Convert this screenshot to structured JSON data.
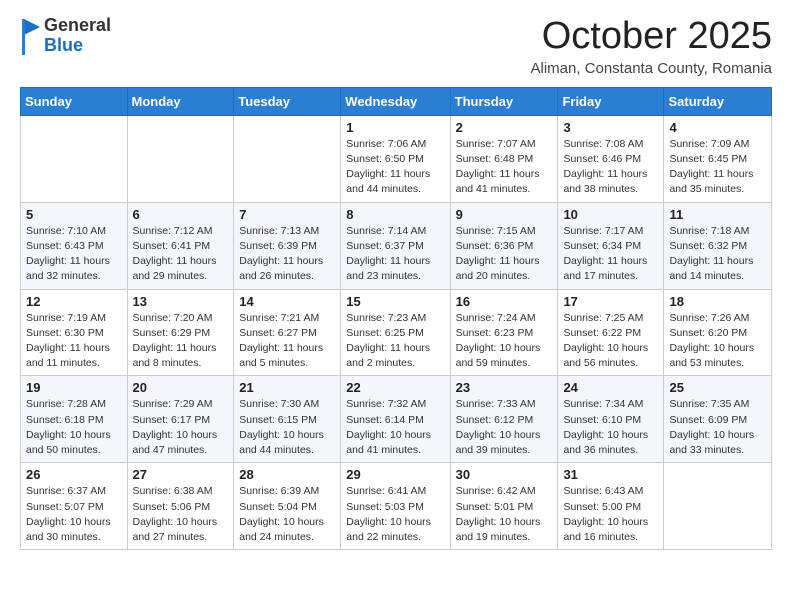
{
  "header": {
    "logo": {
      "general": "General",
      "blue": "Blue"
    },
    "title": "October 2025",
    "location": "Aliman, Constanta County, Romania"
  },
  "calendar": {
    "days_of_week": [
      "Sunday",
      "Monday",
      "Tuesday",
      "Wednesday",
      "Thursday",
      "Friday",
      "Saturday"
    ],
    "weeks": [
      [
        {
          "day": "",
          "info": ""
        },
        {
          "day": "",
          "info": ""
        },
        {
          "day": "",
          "info": ""
        },
        {
          "day": "1",
          "info": "Sunrise: 7:06 AM\nSunset: 6:50 PM\nDaylight: 11 hours and 44 minutes."
        },
        {
          "day": "2",
          "info": "Sunrise: 7:07 AM\nSunset: 6:48 PM\nDaylight: 11 hours and 41 minutes."
        },
        {
          "day": "3",
          "info": "Sunrise: 7:08 AM\nSunset: 6:46 PM\nDaylight: 11 hours and 38 minutes."
        },
        {
          "day": "4",
          "info": "Sunrise: 7:09 AM\nSunset: 6:45 PM\nDaylight: 11 hours and 35 minutes."
        }
      ],
      [
        {
          "day": "5",
          "info": "Sunrise: 7:10 AM\nSunset: 6:43 PM\nDaylight: 11 hours and 32 minutes."
        },
        {
          "day": "6",
          "info": "Sunrise: 7:12 AM\nSunset: 6:41 PM\nDaylight: 11 hours and 29 minutes."
        },
        {
          "day": "7",
          "info": "Sunrise: 7:13 AM\nSunset: 6:39 PM\nDaylight: 11 hours and 26 minutes."
        },
        {
          "day": "8",
          "info": "Sunrise: 7:14 AM\nSunset: 6:37 PM\nDaylight: 11 hours and 23 minutes."
        },
        {
          "day": "9",
          "info": "Sunrise: 7:15 AM\nSunset: 6:36 PM\nDaylight: 11 hours and 20 minutes."
        },
        {
          "day": "10",
          "info": "Sunrise: 7:17 AM\nSunset: 6:34 PM\nDaylight: 11 hours and 17 minutes."
        },
        {
          "day": "11",
          "info": "Sunrise: 7:18 AM\nSunset: 6:32 PM\nDaylight: 11 hours and 14 minutes."
        }
      ],
      [
        {
          "day": "12",
          "info": "Sunrise: 7:19 AM\nSunset: 6:30 PM\nDaylight: 11 hours and 11 minutes."
        },
        {
          "day": "13",
          "info": "Sunrise: 7:20 AM\nSunset: 6:29 PM\nDaylight: 11 hours and 8 minutes."
        },
        {
          "day": "14",
          "info": "Sunrise: 7:21 AM\nSunset: 6:27 PM\nDaylight: 11 hours and 5 minutes."
        },
        {
          "day": "15",
          "info": "Sunrise: 7:23 AM\nSunset: 6:25 PM\nDaylight: 11 hours and 2 minutes."
        },
        {
          "day": "16",
          "info": "Sunrise: 7:24 AM\nSunset: 6:23 PM\nDaylight: 10 hours and 59 minutes."
        },
        {
          "day": "17",
          "info": "Sunrise: 7:25 AM\nSunset: 6:22 PM\nDaylight: 10 hours and 56 minutes."
        },
        {
          "day": "18",
          "info": "Sunrise: 7:26 AM\nSunset: 6:20 PM\nDaylight: 10 hours and 53 minutes."
        }
      ],
      [
        {
          "day": "19",
          "info": "Sunrise: 7:28 AM\nSunset: 6:18 PM\nDaylight: 10 hours and 50 minutes."
        },
        {
          "day": "20",
          "info": "Sunrise: 7:29 AM\nSunset: 6:17 PM\nDaylight: 10 hours and 47 minutes."
        },
        {
          "day": "21",
          "info": "Sunrise: 7:30 AM\nSunset: 6:15 PM\nDaylight: 10 hours and 44 minutes."
        },
        {
          "day": "22",
          "info": "Sunrise: 7:32 AM\nSunset: 6:14 PM\nDaylight: 10 hours and 41 minutes."
        },
        {
          "day": "23",
          "info": "Sunrise: 7:33 AM\nSunset: 6:12 PM\nDaylight: 10 hours and 39 minutes."
        },
        {
          "day": "24",
          "info": "Sunrise: 7:34 AM\nSunset: 6:10 PM\nDaylight: 10 hours and 36 minutes."
        },
        {
          "day": "25",
          "info": "Sunrise: 7:35 AM\nSunset: 6:09 PM\nDaylight: 10 hours and 33 minutes."
        }
      ],
      [
        {
          "day": "26",
          "info": "Sunrise: 6:37 AM\nSunset: 5:07 PM\nDaylight: 10 hours and 30 minutes."
        },
        {
          "day": "27",
          "info": "Sunrise: 6:38 AM\nSunset: 5:06 PM\nDaylight: 10 hours and 27 minutes."
        },
        {
          "day": "28",
          "info": "Sunrise: 6:39 AM\nSunset: 5:04 PM\nDaylight: 10 hours and 24 minutes."
        },
        {
          "day": "29",
          "info": "Sunrise: 6:41 AM\nSunset: 5:03 PM\nDaylight: 10 hours and 22 minutes."
        },
        {
          "day": "30",
          "info": "Sunrise: 6:42 AM\nSunset: 5:01 PM\nDaylight: 10 hours and 19 minutes."
        },
        {
          "day": "31",
          "info": "Sunrise: 6:43 AM\nSunset: 5:00 PM\nDaylight: 10 hours and 16 minutes."
        },
        {
          "day": "",
          "info": ""
        }
      ]
    ]
  }
}
